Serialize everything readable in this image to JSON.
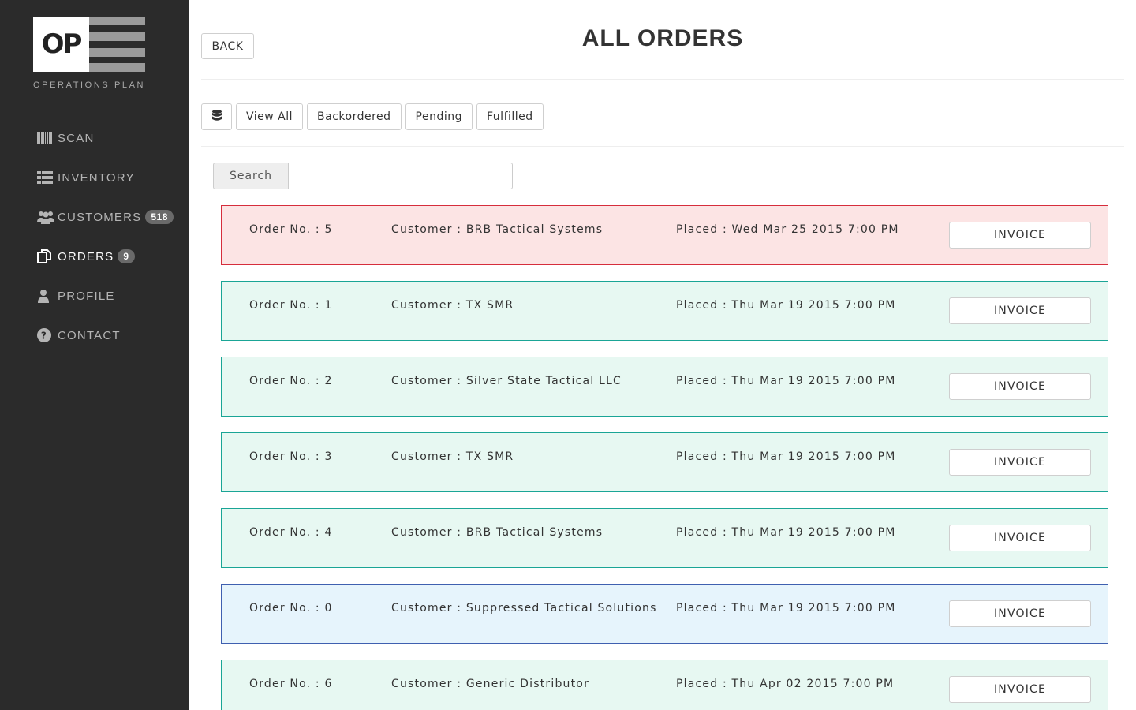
{
  "sidebar": {
    "logo_text": "OP",
    "logo_subtitle": "OPERATIONS PLAN",
    "items": [
      {
        "label": "SCAN",
        "icon": "barcode-icon",
        "badge": ""
      },
      {
        "label": "INVENTORY",
        "icon": "table-icon",
        "badge": ""
      },
      {
        "label": "CUSTOMERS",
        "icon": "users-icon",
        "badge": "518"
      },
      {
        "label": "ORDERS",
        "icon": "copy-icon",
        "badge": "9",
        "active": true
      },
      {
        "label": "PROFILE",
        "icon": "user-icon",
        "badge": ""
      },
      {
        "label": "CONTACT",
        "icon": "question-circle-icon",
        "badge": ""
      }
    ]
  },
  "header": {
    "back_label": "BACK",
    "title": "ALL ORDERS"
  },
  "filters": {
    "db_icon": "database-icon",
    "view_all": "View All",
    "backordered": "Backordered",
    "pending": "Pending",
    "fulfilled": "Fulfilled"
  },
  "search": {
    "label": "Search",
    "value": "",
    "placeholder": ""
  },
  "orders": [
    {
      "no": "Order No. : 5",
      "customer": "Customer : BRB Tactical Systems",
      "placed": "Placed : Wed Mar 25 2015 7:00 PM",
      "status_color": "#d62d3c",
      "invoice": "INVOICE"
    },
    {
      "no": "Order No. : 1",
      "customer": "Customer : TX SMR",
      "placed": "Placed : Thu Mar 19 2015 7:00 PM",
      "status_color": "#1aa596",
      "invoice": "INVOICE"
    },
    {
      "no": "Order No. : 2",
      "customer": "Customer : Silver State Tactical LLC",
      "placed": "Placed : Thu Mar 19 2015 7:00 PM",
      "status_color": "#1aa596",
      "invoice": "INVOICE"
    },
    {
      "no": "Order No. : 3",
      "customer": "Customer : TX SMR",
      "placed": "Placed : Thu Mar 19 2015 7:00 PM",
      "status_color": "#1aa596",
      "invoice": "INVOICE"
    },
    {
      "no": "Order No. : 4",
      "customer": "Customer : BRB Tactical Systems",
      "placed": "Placed : Thu Mar 19 2015 7:00 PM",
      "status_color": "#1aa596",
      "invoice": "INVOICE"
    },
    {
      "no": "Order No. : 0",
      "customer": "Customer : Suppressed Tactical Solutions",
      "placed": "Placed : Thu Mar 19 2015 7:00 PM",
      "status_color": "#3f5fb0",
      "invoice": "INVOICE"
    },
    {
      "no": "Order No. : 6",
      "customer": "Customer : Generic Distributor",
      "placed": "Placed : Thu Apr 02 2015 7:00 PM",
      "status_color": "#1aa596",
      "invoice": "INVOICE"
    }
  ]
}
